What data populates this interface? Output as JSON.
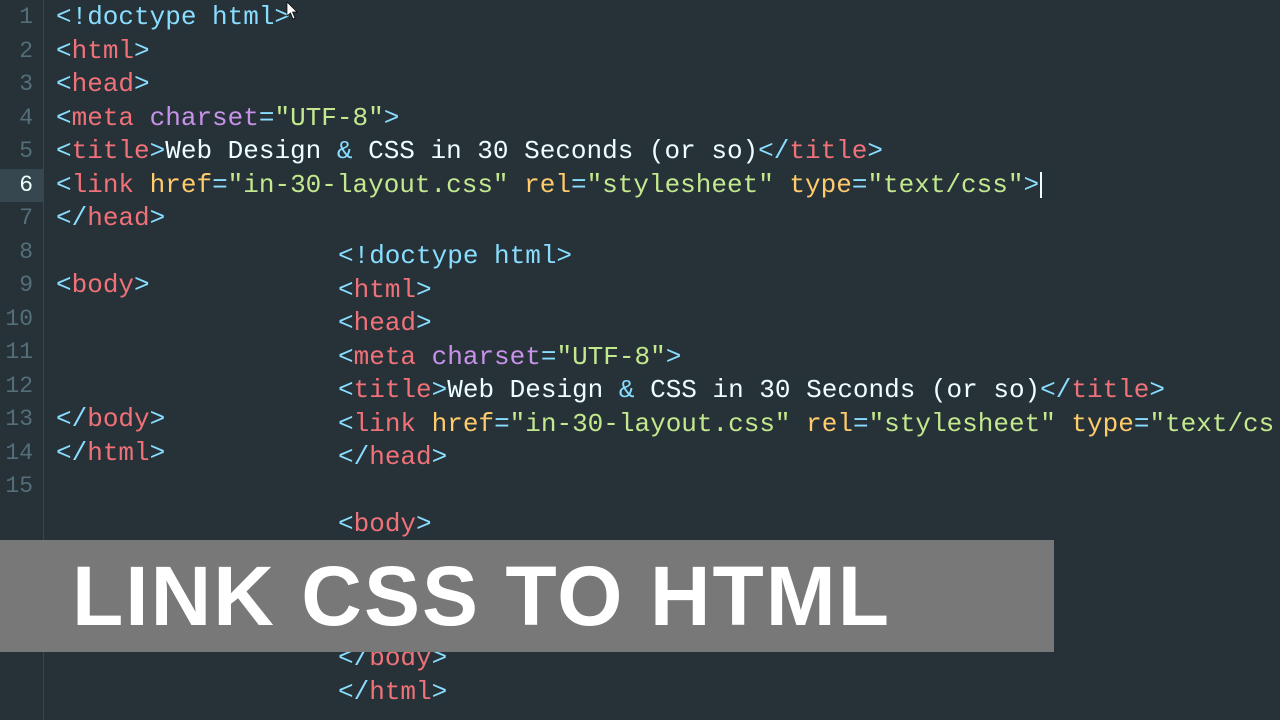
{
  "cursor": {
    "line": 6
  },
  "lines": {
    "l1": {
      "doctype": "<!doctype html>"
    },
    "l2": {
      "open": "<",
      "tag": "html",
      "close": ">"
    },
    "l3": {
      "open": "<",
      "tag": "head",
      "close": ">"
    },
    "l4": {
      "open": "<",
      "tag": "meta",
      "sp": " ",
      "attr": "charset",
      "eq": "=",
      "val": "\"UTF-8\"",
      "close": ">"
    },
    "l5": {
      "open": "<",
      "tag": "title",
      "close1": ">",
      "text1": "Web Design ",
      "amp": "&",
      "text2": " CSS in 30 Seconds (or so)",
      "open2": "</",
      "tag2": "title",
      "close2": ">"
    },
    "l6": {
      "open": "<",
      "tag": "link",
      "sp": " ",
      "a1": "href",
      "eq1": "=",
      "v1": "\"in-30-layout.css\"",
      "sp2": " ",
      "a2": "rel",
      "eq2": "=",
      "v2": "\"stylesheet\"",
      "sp3": " ",
      "a3": "type",
      "eq3": "=",
      "v3": "\"text/css\"",
      "close": ">"
    },
    "l7": {
      "open": "</",
      "tag": "head",
      "close": ">"
    },
    "l9": {
      "open": "<",
      "tag": "body",
      "close": ">"
    },
    "l13": {
      "open": "</",
      "tag": "body",
      "close": ">"
    },
    "l14": {
      "open": "</",
      "tag": "html",
      "close": ">"
    }
  },
  "overlay": {
    "o1": {
      "doctype": "<!doctype html>"
    },
    "o2": {
      "open": "<",
      "tag": "html",
      "close": ">"
    },
    "o3": {
      "open": "<",
      "tag": "head",
      "close": ">"
    },
    "o4": {
      "open": "<",
      "tag": "meta",
      "sp": " ",
      "attr": "charset",
      "eq": "=",
      "val": "\"UTF-8\"",
      "close": ">"
    },
    "o5": {
      "open": "<",
      "tag": "title",
      "close1": ">",
      "text1": "Web Design ",
      "amp": "&",
      "text2": " CSS in 30 Seconds (or so)",
      "open2": "</",
      "tag2": "title",
      "close2": ">"
    },
    "o6": {
      "open": "<",
      "tag": "link",
      "sp": " ",
      "a1": "href",
      "eq1": "=",
      "v1": "\"in-30-layout.css\"",
      "sp2": " ",
      "a2": "rel",
      "eq2": "=",
      "v2": "\"stylesheet\"",
      "sp3": " ",
      "a3": "type",
      "eq3": "=",
      "v3": "\"text/cs"
    },
    "o7": {
      "open": "</",
      "tag": "head",
      "close": ">"
    },
    "o9": {
      "open": "<",
      "tag": "body",
      "close": ">"
    },
    "o13": {
      "open": "</",
      "tag": "body",
      "close": ">"
    },
    "o14": {
      "open": "</",
      "tag": "html",
      "close": ">"
    }
  },
  "gutter": [
    "1",
    "2",
    "3",
    "4",
    "5",
    "6",
    "7",
    "8",
    "9",
    "10",
    "11",
    "12",
    "13",
    "14",
    "15"
  ],
  "banner": {
    "text": "LINK CSS TO HTML"
  }
}
